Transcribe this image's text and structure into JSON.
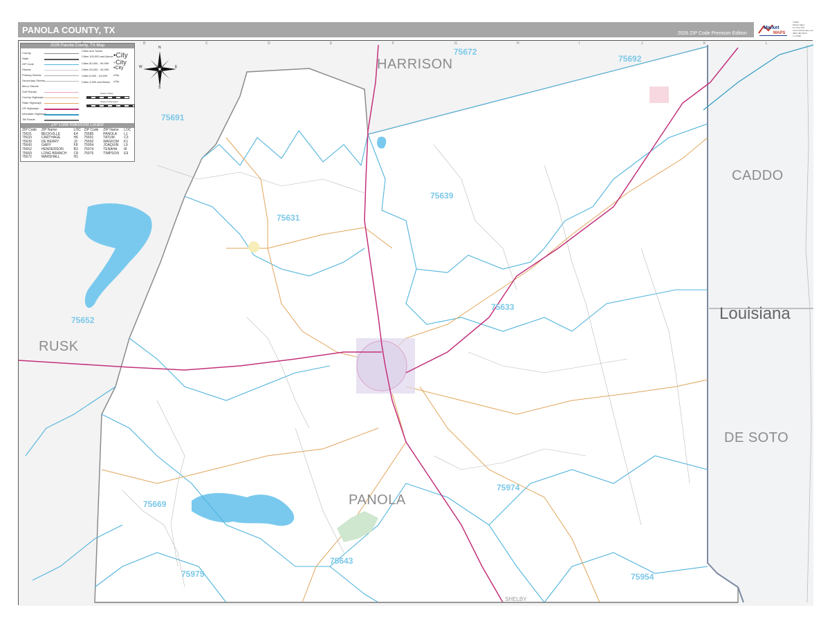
{
  "header": {
    "title": "PANOLA COUNTY, TX",
    "edition": "2026 ZIP Code Premium Edition"
  },
  "logo": {
    "brand": "Market MAPS",
    "fine_print": [
      "©2026",
      "Market Maps",
      "St. Paul, MN",
      "www.marketmaps.com",
      "(800) 382-5640",
      "1-2-3456"
    ]
  },
  "legend": {
    "title": "2026 Panola County, TX Map",
    "rows": [
      "County",
      "State",
      "ZIP Code",
      "Streets",
      "Primary Streets",
      "Secondary Streets",
      "Minor Streets",
      "Golf Ramps",
      "County Highways",
      "State Highways",
      "US Highways",
      "Interstate Highways",
      "Toll Roads"
    ],
    "city_header": "Cities and Towns",
    "cities": [
      {
        "text": "Cities 100,000 and Above",
        "sample": "•City"
      },
      {
        "text": "Cities 50,000 - 99,999",
        "sample": "◦City"
      },
      {
        "text": "Cities 25,000 - 49,999",
        "sample": "•City"
      },
      {
        "text": "Cities 5,000 - 24,999",
        "sample": "•City"
      },
      {
        "text": "Cities 4,999 and Below",
        "sample": "•City"
      }
    ],
    "scale_label": "Scale in Miles",
    "scale_label_km": "Scale in Kilometers",
    "zip_title": "ZIP Code Index/Grid Locator",
    "zip_headers": [
      "ZIP Code",
      "ZIP Name",
      "LOC",
      "ZIP Code",
      "ZIP Name",
      "LOC"
    ],
    "zip_rows": [
      [
        "75631",
        "BECKVILLE",
        "E4",
        "75685",
        "PANOLA",
        "L1"
      ],
      [
        "75633",
        "CARTHAGE",
        "H6",
        "75691",
        "TATUM",
        "C3"
      ],
      [
        "75639",
        "DE BERRY",
        "J3",
        "75692",
        "WASKOM",
        "K1"
      ],
      [
        "75643",
        "GARY",
        "F8",
        "75954",
        "JOAQUIN",
        "L9"
      ],
      [
        "75652",
        "HENDERSON",
        "B3",
        "75974",
        "TENAHA",
        "I8"
      ],
      [
        "75669",
        "LONG BRANCH",
        "C8",
        "75975",
        "TIMPSON",
        "E9"
      ],
      [
        "75672",
        "MARSHALL",
        "H1",
        "",
        "",
        ""
      ]
    ]
  },
  "compass": {
    "n": "N",
    "s": "S",
    "e": "E",
    "w": "W"
  },
  "map": {
    "counties": [
      {
        "name": "HARRISON",
        "id": "harrison"
      },
      {
        "name": "CADDO",
        "id": "caddo"
      },
      {
        "name": "RUSK",
        "id": "rusk"
      },
      {
        "name": "DE SOTO",
        "id": "desoto"
      },
      {
        "name": "PANOLA",
        "id": "panola"
      },
      {
        "name": "SHELBY",
        "id": "shelby"
      }
    ],
    "state": "Louisiana",
    "zips": [
      "75672",
      "75692",
      "75691",
      "75631",
      "75639",
      "75633",
      "75652",
      "75974",
      "75669",
      "75643",
      "75975",
      "75954"
    ],
    "grid_letters": [
      "A",
      "B",
      "C",
      "D",
      "E",
      "F",
      "G",
      "H",
      "I",
      "J",
      "K",
      "L",
      "M"
    ],
    "colors": {
      "background": "#f3f3f3",
      "county_fill": "#ffffff",
      "zip_boundary": "#4fb3dc",
      "water": "#79c9ee",
      "us_highway": "#c2307a",
      "state_highway": "#e1a45a",
      "county_border": "#8a8a8a",
      "carthage_area": "#e0d5ec"
    }
  }
}
